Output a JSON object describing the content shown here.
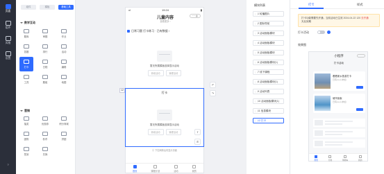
{
  "rail": {
    "items": [
      {
        "label": "页面",
        "active": true
      },
      {
        "label": "组件"
      },
      {
        "label": "风格"
      },
      {
        "label": "设置"
      }
    ]
  },
  "widgets": {
    "tabs": [
      "组件",
      "模板",
      "基础工具"
    ],
    "selected_tab": 2,
    "section1": "数学互动",
    "section1_items": [
      "题库",
      "审题",
      "作业",
      "答题",
      "排行",
      "活动",
      "打卡",
      "日程",
      "编辑",
      "工具",
      "题组",
      "地图"
    ],
    "selected_item": 6,
    "section2": "营销",
    "section2_items": [
      "抽奖",
      "优惠券",
      "积分商城",
      "团购",
      "秒杀",
      "拼团",
      "签到",
      "兑换"
    ]
  },
  "phone": {
    "time": "19:24",
    "signal": "ııl",
    "battery": "▮",
    "title": "儿童内容",
    "subtitle": "查看更多 ›",
    "capsule": "··· ◎",
    "banner": "日常习题  打卡练习  · 已有数据 ›",
    "empty_text": "暂无所属模板选择显示活动",
    "btn_a": "新增活动",
    "btn_b": "管理活动",
    "block_title": "打卡",
    "block_empty": "暂无所属模板选择显示活动",
    "block_btn_a": "新增活动",
    "block_btn_b": "管理活动",
    "footer_hint": "⓵ 下拉刷新后将显示页面",
    "tabbar": [
      "首页",
      "课程计划",
      "活动",
      "我的"
    ],
    "tabbar_active": 0,
    "side_num": "12"
  },
  "modules": {
    "header": "模块列表",
    "items": [
      "1 轮播图片",
      "2 图标导航",
      "3 活动面板模块",
      "4 活动面板模块",
      "5 活动面板模块",
      "6 活动面板模块(1)",
      "7 线下课程",
      "8 活动面板模块(1)",
      "9 活动列表",
      "10 活动面板模块(1)",
      "11 信息模块",
      "12 打卡"
    ],
    "selected": 11
  },
  "config": {
    "tabs": [
      "打卡",
      "样式"
    ],
    "selected_tab": 0,
    "notice_line1": "打卡功能需要先开通，当前活动已生效 2024-04-22 120",
    "notice_link": "去开通",
    "notice_line2": "天后到期",
    "toggle_label": "打卡活动",
    "preview_label": "效果图",
    "preview": {
      "title": "小程序",
      "subtitle": "打卡活动",
      "card1_title": "看看家乡旅游打卡",
      "card1_sub": "已有xxx人参加",
      "card2_title": "城市探索",
      "card2_sub": "已有xxx人参加",
      "tabbar": [
        "首页",
        "分类",
        "购物车",
        "我的"
      ]
    }
  },
  "colors": {
    "accent": "#2f6bff",
    "rail": "#2b2f3a"
  }
}
